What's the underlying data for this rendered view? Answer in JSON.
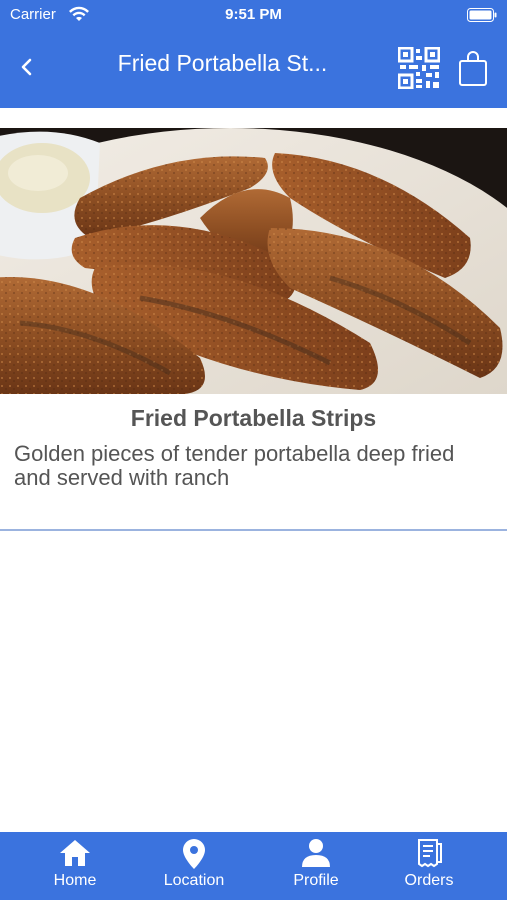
{
  "status_bar": {
    "carrier": "Carrier",
    "time": "9:51 PM"
  },
  "nav_bar": {
    "title": "Fried Portabella St..."
  },
  "item": {
    "title": "Fried Portabella Strips",
    "description": "Golden pieces of tender portabella deep fried and served with ranch"
  },
  "tab_bar": {
    "tabs": [
      {
        "label": "Home",
        "icon": "home-icon"
      },
      {
        "label": "Location",
        "icon": "location-pin-icon"
      },
      {
        "label": "Profile",
        "icon": "profile-icon"
      },
      {
        "label": "Orders",
        "icon": "receipt-icon"
      }
    ]
  },
  "colors": {
    "brand": "#3b73de",
    "text": "#555555",
    "divider": "#9bb3df"
  }
}
